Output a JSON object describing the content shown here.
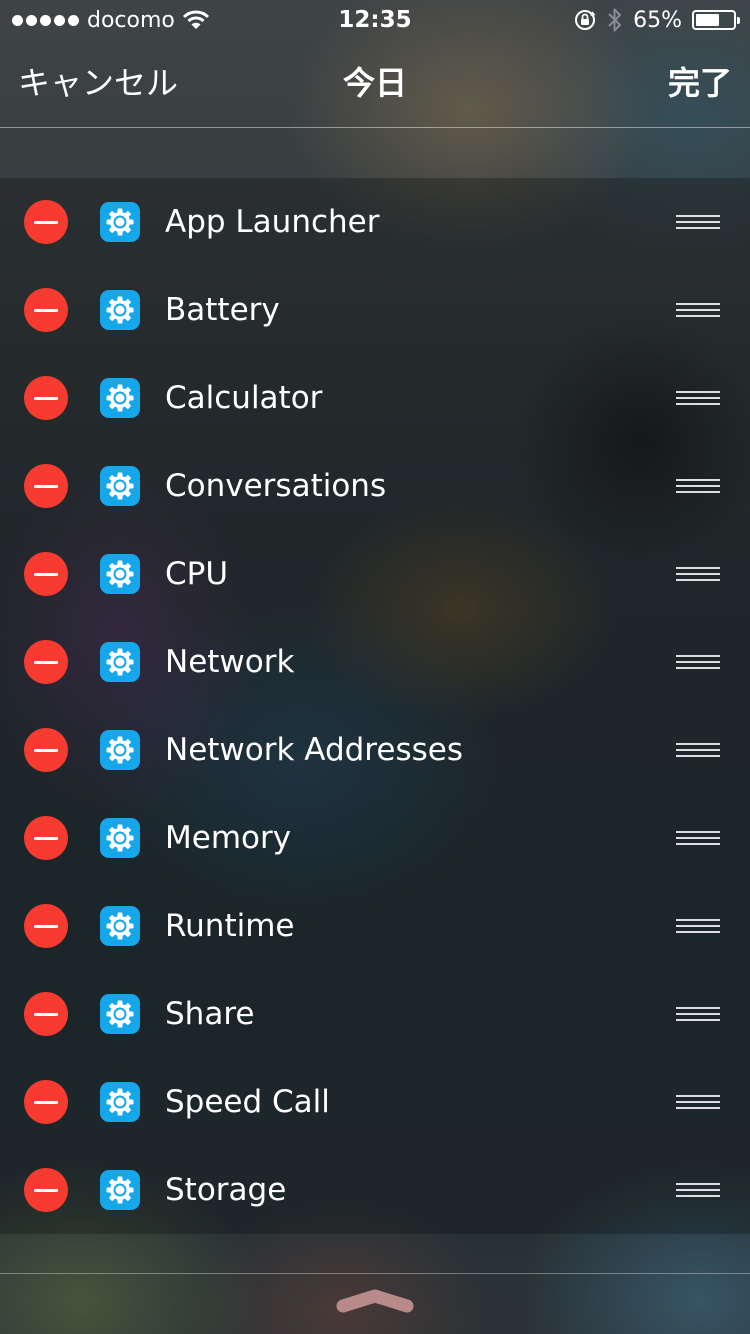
{
  "status_bar": {
    "carrier": "docomo",
    "time": "12:35",
    "battery_percent": "65%",
    "battery_level": 0.65,
    "icons": [
      "signal-dots-icon",
      "wifi-icon",
      "orientation-lock-icon",
      "bluetooth-icon",
      "battery-icon"
    ]
  },
  "nav": {
    "cancel_label": "キャンセル",
    "title": "今日",
    "done_label": "完了"
  },
  "widgets": [
    {
      "label": "App Launcher",
      "icon": "gear-icon"
    },
    {
      "label": "Battery",
      "icon": "gear-icon"
    },
    {
      "label": "Calculator",
      "icon": "gear-icon"
    },
    {
      "label": "Conversations",
      "icon": "gear-icon"
    },
    {
      "label": "CPU",
      "icon": "gear-icon"
    },
    {
      "label": "Network",
      "icon": "gear-icon"
    },
    {
      "label": "Network Addresses",
      "icon": "gear-icon"
    },
    {
      "label": "Memory",
      "icon": "gear-icon"
    },
    {
      "label": "Runtime",
      "icon": "gear-icon"
    },
    {
      "label": "Share",
      "icon": "gear-icon"
    },
    {
      "label": "Speed Call",
      "icon": "gear-icon"
    },
    {
      "label": "Storage",
      "icon": "gear-icon"
    }
  ],
  "colors": {
    "delete_red": "#f73b30",
    "icon_blue": "#16a6ea",
    "grabber": "#b88a8a"
  }
}
